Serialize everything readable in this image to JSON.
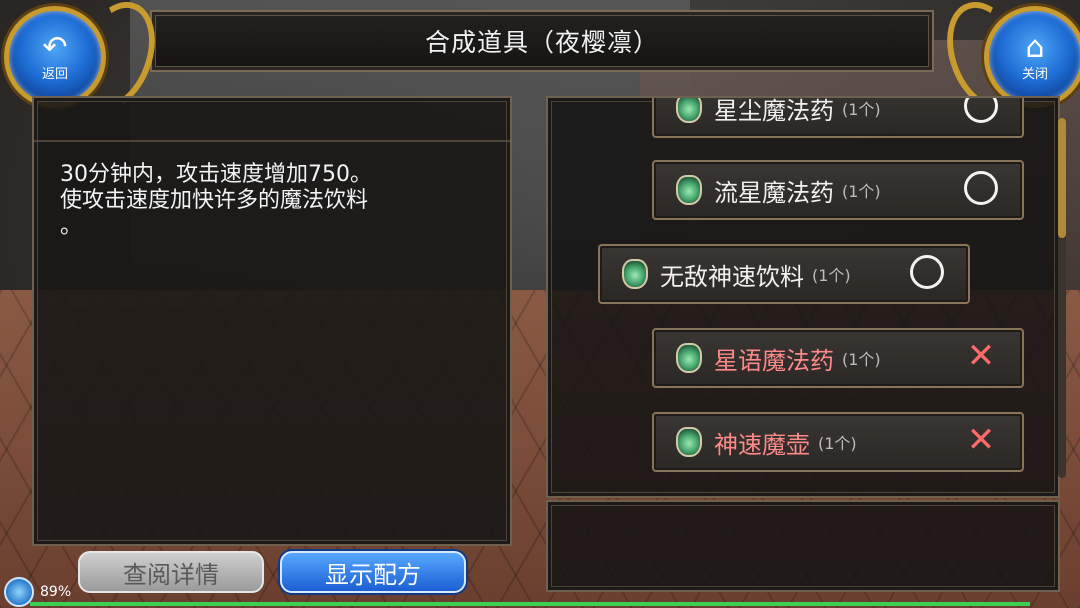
{
  "header": {
    "title": "合成道具（夜樱凛）",
    "back_label": "返回",
    "close_label": "关闭"
  },
  "description": {
    "text_line1": "30分钟内，攻击速度增加750。",
    "text_line2": "使攻击速度加快许多的魔法饮料",
    "text_line3": "。"
  },
  "buttons": {
    "view_details": "查阅详情",
    "show_recipe": "显示配方"
  },
  "items": [
    {
      "name": "星尘魔法药",
      "count": "(1个)",
      "status": "circle"
    },
    {
      "name": "流星魔法药",
      "count": "(1个)",
      "status": "circle"
    },
    {
      "name": "无敌神速饮料",
      "count": "(1个)",
      "status": "circle"
    },
    {
      "name": "星语魔法药",
      "count": "(1个)",
      "status": "cross"
    },
    {
      "name": "神速魔壶",
      "count": "(1个)",
      "status": "cross"
    }
  ],
  "status": {
    "battery": "89%"
  },
  "colors": {
    "missing_item_text": "#ff8a8a",
    "primary_button": "#1b5fd3"
  }
}
